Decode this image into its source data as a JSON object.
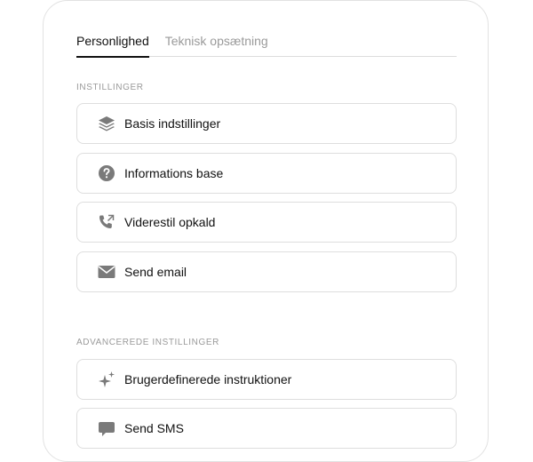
{
  "tabs": [
    {
      "label": "Personlighed",
      "active": true
    },
    {
      "label": "Teknisk opsætning",
      "active": false
    }
  ],
  "sections": {
    "settings": {
      "label": "INSTILLINGER",
      "items": [
        {
          "label": "Basis indstillinger",
          "icon": "layers-icon"
        },
        {
          "label": "Informations base",
          "icon": "question-circle-icon"
        },
        {
          "label": "Viderestil opkald",
          "icon": "phone-forward-icon"
        },
        {
          "label": "Send email",
          "icon": "envelope-icon"
        }
      ]
    },
    "advanced": {
      "label": "ADVANCEREDE INSTILLINGER",
      "items": [
        {
          "label": "Brugerdefinerede instruktioner",
          "icon": "sparkles-icon"
        },
        {
          "label": "Send SMS",
          "icon": "message-icon"
        }
      ]
    }
  },
  "colors": {
    "accent": "#111111",
    "muted": "#9a9a9a",
    "border": "#dedede",
    "icon": "#7a7a7a"
  }
}
